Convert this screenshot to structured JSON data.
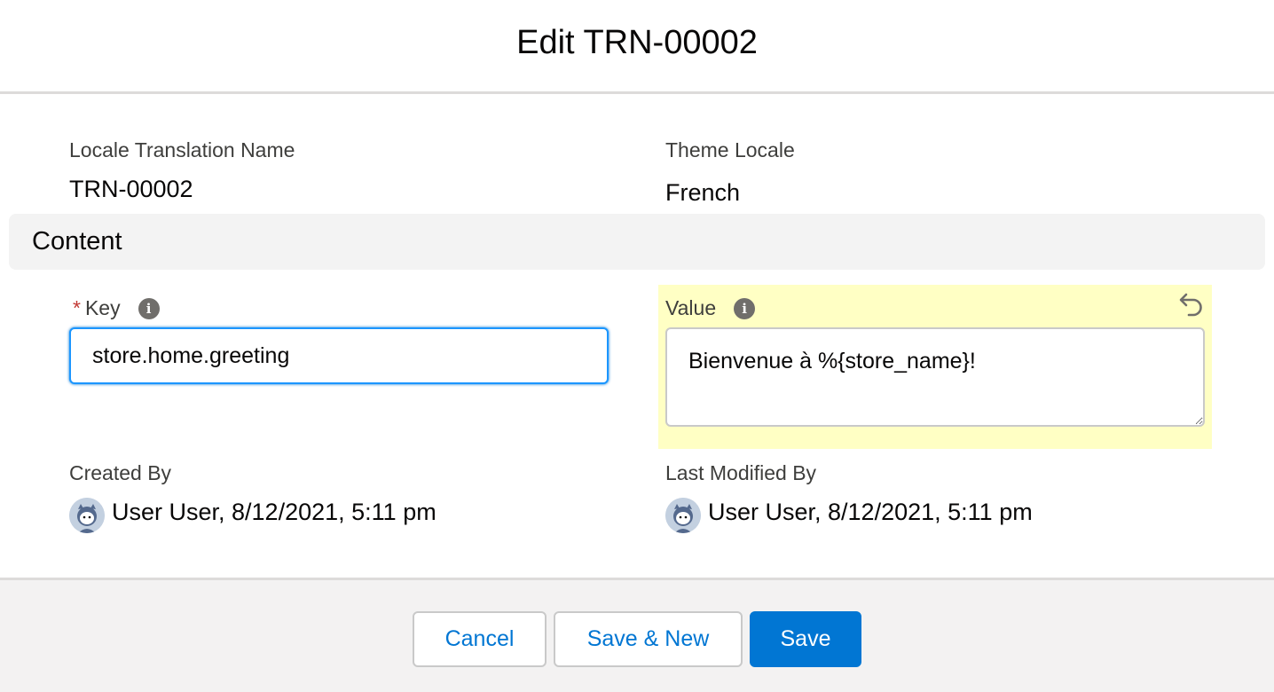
{
  "header": {
    "title": "Edit TRN-00002"
  },
  "fields": {
    "locale_translation_name": {
      "label": "Locale Translation Name",
      "value": "TRN-00002"
    },
    "theme_locale": {
      "label": "Theme Locale",
      "value": "French"
    }
  },
  "section": {
    "title": "Content"
  },
  "key": {
    "required_marker": "*",
    "label": "Key",
    "value": "store.home.greeting",
    "info_icon": "info-icon"
  },
  "value_field": {
    "label": "Value",
    "value": "Bienvenue à %{store_name}!",
    "info_icon": "info-icon",
    "undo_icon": "undo-icon",
    "highlight_color": "#ffffc4"
  },
  "created_by": {
    "label": "Created By",
    "value": "User User, 8/12/2021, 5:11 pm"
  },
  "last_modified_by": {
    "label": "Last Modified By",
    "value": "User User, 8/12/2021, 5:11 pm"
  },
  "footer": {
    "cancel_label": "Cancel",
    "save_new_label": "Save & New",
    "save_label": "Save"
  },
  "colors": {
    "brand": "#0176d3",
    "required": "#c23934",
    "focus_border": "#1b96ff"
  }
}
